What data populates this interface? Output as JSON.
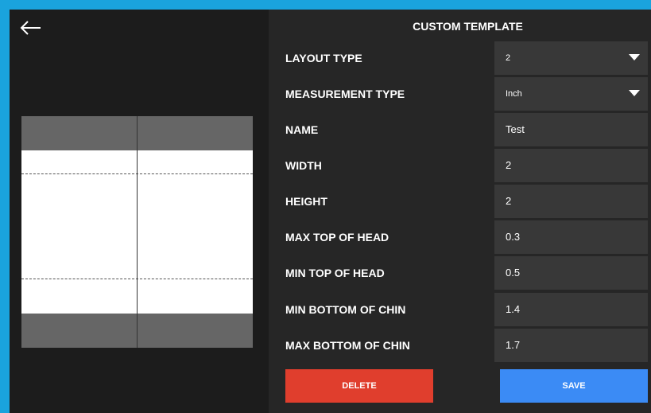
{
  "colors": {
    "frame": "#1aa3dd",
    "left_bg": "#1c1c1c",
    "right_bg": "#262626",
    "field_bg": "#383838",
    "preview_band": "#666666",
    "delete": "#e03e2d",
    "save": "#3b8bf5"
  },
  "header": {
    "back_icon": "arrow-left-icon",
    "title": "CUSTOM TEMPLATE"
  },
  "form": {
    "layout_type": {
      "label": "LAYOUT TYPE",
      "value": "2",
      "icon": "caret-down-icon"
    },
    "measurement_type": {
      "label": "MEASUREMENT TYPE",
      "value": "Inch",
      "icon": "caret-down-icon"
    },
    "name": {
      "label": "NAME",
      "value": "Test"
    },
    "width": {
      "label": "WIDTH",
      "value": "2"
    },
    "height": {
      "label": "HEIGHT",
      "value": "2"
    },
    "max_top_of_head": {
      "label": "MAX TOP OF HEAD",
      "value": "0.3"
    },
    "min_top_of_head": {
      "label": "MIN TOP OF HEAD",
      "value": "0.5"
    },
    "min_bottom_of_chin": {
      "label": "MIN BOTTOM OF CHIN",
      "value": "1.4"
    },
    "max_bottom_of_chin": {
      "label": "MAX BOTTOM OF CHIN",
      "value": "1.7"
    }
  },
  "buttons": {
    "delete_label": "DELETE",
    "save_label": "SAVE"
  }
}
